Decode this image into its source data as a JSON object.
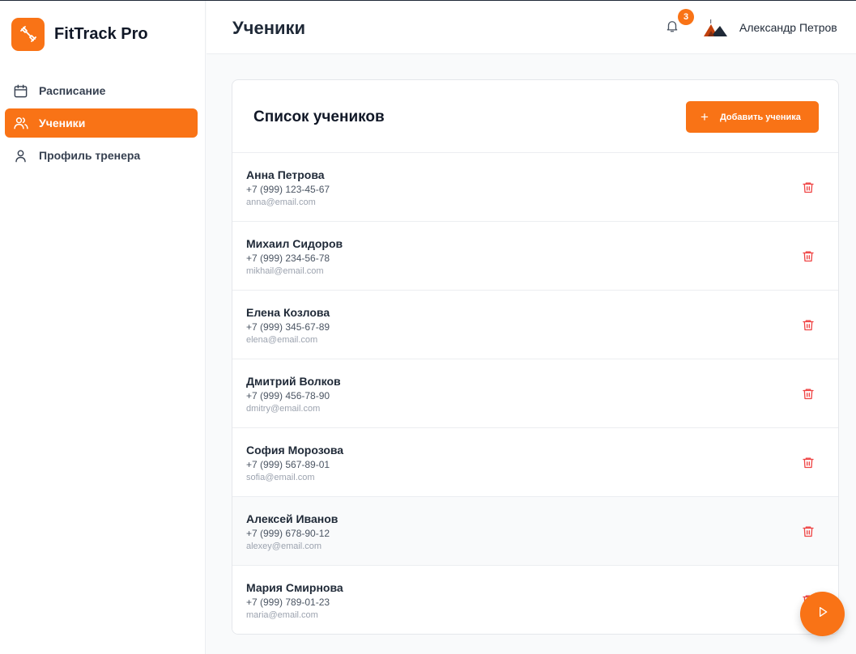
{
  "app": {
    "name": "FitTrack Pro",
    "accent": "#f97316"
  },
  "sidebar": {
    "items": [
      {
        "label": "Расписание",
        "icon": "calendar-icon",
        "active": false
      },
      {
        "label": "Ученики",
        "icon": "users-icon",
        "active": true
      },
      {
        "label": "Профиль тренера",
        "icon": "user-icon",
        "active": false
      }
    ]
  },
  "header": {
    "title": "Ученики",
    "notifications": "3",
    "user_name": "Александр Петров"
  },
  "main": {
    "card_title": "Список учеников",
    "add_label": "Добавить ученика",
    "students": [
      {
        "name": "Анна Петрова",
        "phone": "+7 (999) 123-45-67",
        "email": "anna@email.com"
      },
      {
        "name": "Михаил Сидоров",
        "phone": "+7 (999) 234-56-78",
        "email": "mikhail@email.com"
      },
      {
        "name": "Елена Козлова",
        "phone": "+7 (999) 345-67-89",
        "email": "elena@email.com"
      },
      {
        "name": "Дмитрий Волков",
        "phone": "+7 (999) 456-78-90",
        "email": "dmitry@email.com"
      },
      {
        "name": "София Морозова",
        "phone": "+7 (999) 567-89-01",
        "email": "sofia@email.com"
      },
      {
        "name": "Алексей Иванов",
        "phone": "+7 (999) 678-90-12",
        "email": "alexey@email.com"
      },
      {
        "name": "Мария Смирнова",
        "phone": "+7 (999) 789-01-23",
        "email": "maria@email.com"
      }
    ]
  }
}
